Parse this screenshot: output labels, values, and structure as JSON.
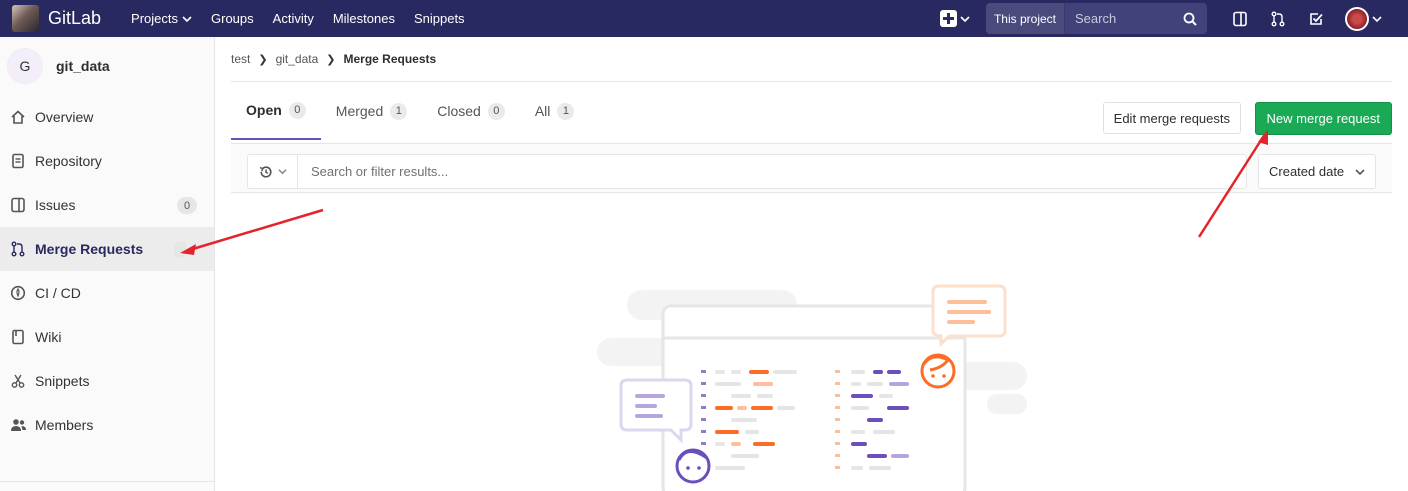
{
  "topnav": {
    "brand": "GitLab",
    "links": [
      {
        "label": "Projects",
        "has_caret": true
      },
      {
        "label": "Groups"
      },
      {
        "label": "Activity"
      },
      {
        "label": "Milestones"
      },
      {
        "label": "Snippets"
      }
    ],
    "search_scope": "This project",
    "search_placeholder": "Search",
    "icons": [
      "plus-square-icon",
      "sidebar-panel-icon",
      "merge-request-icon",
      "todo-check-icon"
    ]
  },
  "sidebar": {
    "project_initial": "G",
    "project_name": "git_data",
    "items": [
      {
        "label": "Overview",
        "icon": "home-icon"
      },
      {
        "label": "Repository",
        "icon": "repository-icon"
      },
      {
        "label": "Issues",
        "icon": "issues-icon",
        "count": "0"
      },
      {
        "label": "Merge Requests",
        "icon": "merge-request-icon",
        "active": true
      },
      {
        "label": "CI / CD",
        "icon": "rocket-icon"
      },
      {
        "label": "Wiki",
        "icon": "book-icon"
      },
      {
        "label": "Snippets",
        "icon": "scissors-icon"
      },
      {
        "label": "Members",
        "icon": "users-icon"
      }
    ]
  },
  "breadcrumb": {
    "items": [
      "test",
      "git_data"
    ],
    "current": "Merge Requests"
  },
  "tabs": [
    {
      "label": "Open",
      "count": "0",
      "active": true
    },
    {
      "label": "Merged",
      "count": "1"
    },
    {
      "label": "Closed",
      "count": "0"
    },
    {
      "label": "All",
      "count": "1"
    }
  ],
  "actions": {
    "edit": "Edit merge requests",
    "new": "New merge request"
  },
  "filter": {
    "placeholder": "Search or filter results...",
    "sort": "Created date"
  },
  "colors": {
    "nav": "#292961",
    "accent": "#6b4fbb",
    "success": "#1aaa55",
    "annotation_arrow": "#e3242b"
  }
}
